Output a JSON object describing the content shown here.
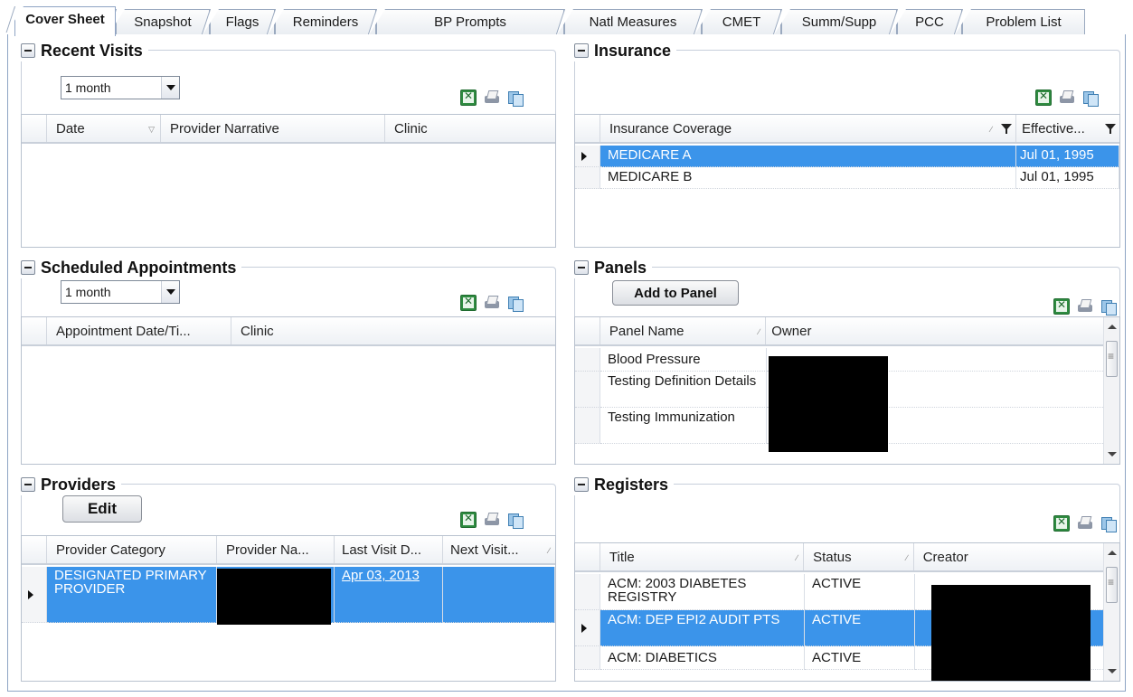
{
  "tabs": [
    {
      "label": "Cover Sheet",
      "active": true
    },
    {
      "label": "Snapshot"
    },
    {
      "label": "Flags"
    },
    {
      "label": "Reminders"
    },
    {
      "label": "BP Prompts"
    },
    {
      "label": "Natl Measures"
    },
    {
      "label": "CMET"
    },
    {
      "label": "Summ/Supp"
    },
    {
      "label": "PCC"
    },
    {
      "label": "Problem List"
    }
  ],
  "toolbar_icons": [
    "excel-export-icon",
    "print-icon",
    "copy-icon"
  ],
  "recent_visits": {
    "title": "Recent Visits",
    "range": "1 month",
    "columns": [
      "Date",
      "Provider Narrative",
      "Clinic"
    ],
    "rows": []
  },
  "insurance": {
    "title": "Insurance",
    "columns": [
      "Insurance Coverage",
      "Effective..."
    ],
    "rows": [
      {
        "coverage": "MEDICARE A",
        "effective": "Jul 01, 1995",
        "selected": true
      },
      {
        "coverage": "MEDICARE B",
        "effective": "Jul 01, 1995",
        "selected": false
      }
    ]
  },
  "scheduled_appointments": {
    "title": "Scheduled Appointments",
    "range": "1 month",
    "columns": [
      "Appointment Date/Ti...",
      "Clinic"
    ],
    "rows": []
  },
  "panels": {
    "title": "Panels",
    "add_button": "Add to Panel",
    "columns": [
      "Panel Name",
      "Owner"
    ],
    "rows": [
      {
        "name": "Blood Pressure"
      },
      {
        "name": "Testing Definition Details"
      },
      {
        "name": "Testing Immunization"
      }
    ]
  },
  "providers": {
    "title": "Providers",
    "edit_button": "Edit",
    "columns": [
      "Provider Category",
      "Provider Na...",
      "Last Visit D...",
      "Next Visit..."
    ],
    "rows": [
      {
        "category": "DESIGNATED PRIMARY PROVIDER",
        "last_visit": "Apr 03, 2013",
        "selected": true
      }
    ]
  },
  "registers": {
    "title": "Registers",
    "columns": [
      "Title",
      "Status",
      "Creator"
    ],
    "rows": [
      {
        "title": "ACM: 2003 DIABETES REGISTRY",
        "status": "ACTIVE",
        "selected": false
      },
      {
        "title": "ACM: DEP EPI2 AUDIT PTS",
        "status": "ACTIVE",
        "selected": true
      },
      {
        "title": "ACM: DIABETICS",
        "status": "ACTIVE",
        "selected": false
      }
    ]
  },
  "colors": {
    "selection": "#3b94ea",
    "frame_border": "#8ea4c4",
    "redaction": "#000000"
  }
}
